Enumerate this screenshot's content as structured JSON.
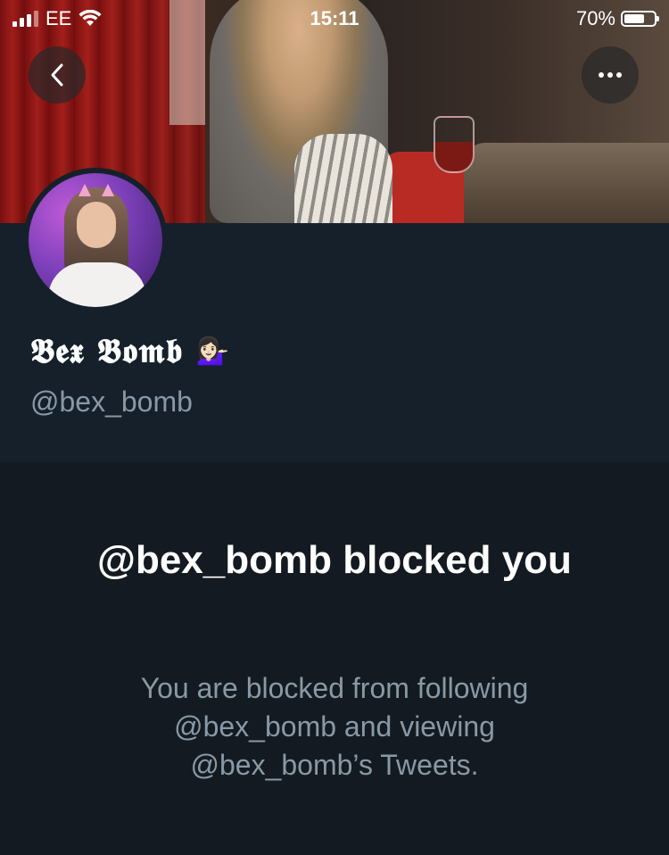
{
  "status_bar": {
    "carrier": "EE",
    "time": "15:11",
    "battery_percent_label": "70%",
    "battery_level": 0.7
  },
  "header": {
    "back_icon": "chevron-left-icon",
    "more_icon": "more-horizontal-icon"
  },
  "profile": {
    "display_name": "𝕭𝖊𝖝 𝕭𝖔𝖒𝖇",
    "display_name_emoji": "💁🏻‍♀️",
    "handle": "@bex_bomb"
  },
  "blocked": {
    "title": "@bex_bomb blocked you",
    "description": "You are blocked from following @bex_bomb and viewing @bex_bomb’s Tweets."
  },
  "colors": {
    "background": "#15202b",
    "blocked_background": "#141a21",
    "secondary_text": "#8899a6",
    "primary_text": "#ffffff"
  }
}
